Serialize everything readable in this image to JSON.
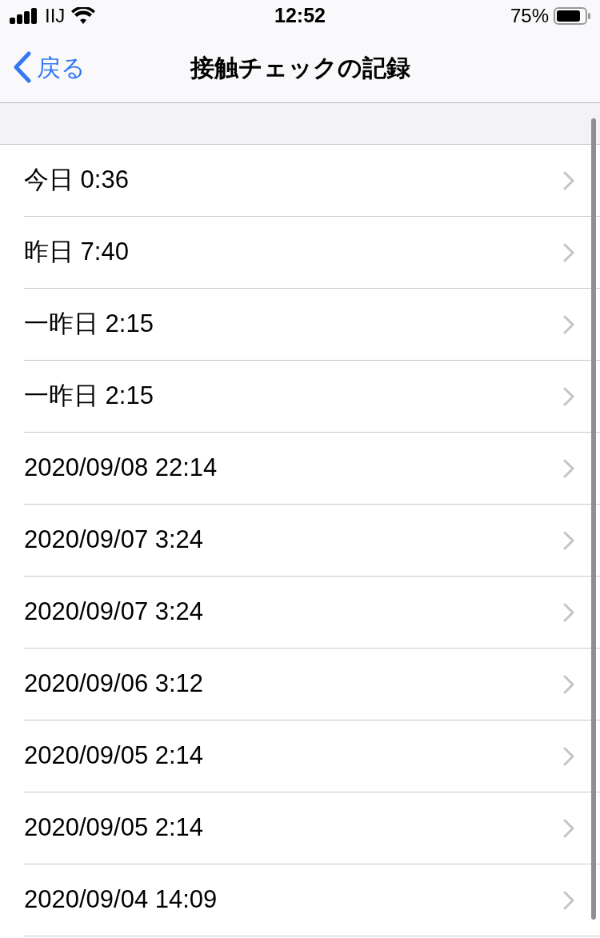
{
  "status_bar": {
    "carrier": "IIJ",
    "time": "12:52",
    "battery": "75%"
  },
  "nav_bar": {
    "back": "戻る",
    "title": "接触チェックの記録"
  },
  "records": [
    {
      "label": "今日 0:36"
    },
    {
      "label": "昨日 7:40"
    },
    {
      "label": "一昨日 2:15"
    },
    {
      "label": "一昨日 2:15"
    },
    {
      "label": "2020/09/08 22:14"
    },
    {
      "label": "2020/09/07 3:24"
    },
    {
      "label": "2020/09/07 3:24"
    },
    {
      "label": "2020/09/06 3:12"
    },
    {
      "label": "2020/09/05 2:14"
    },
    {
      "label": "2020/09/05 2:14"
    },
    {
      "label": "2020/09/04 14:09"
    }
  ]
}
